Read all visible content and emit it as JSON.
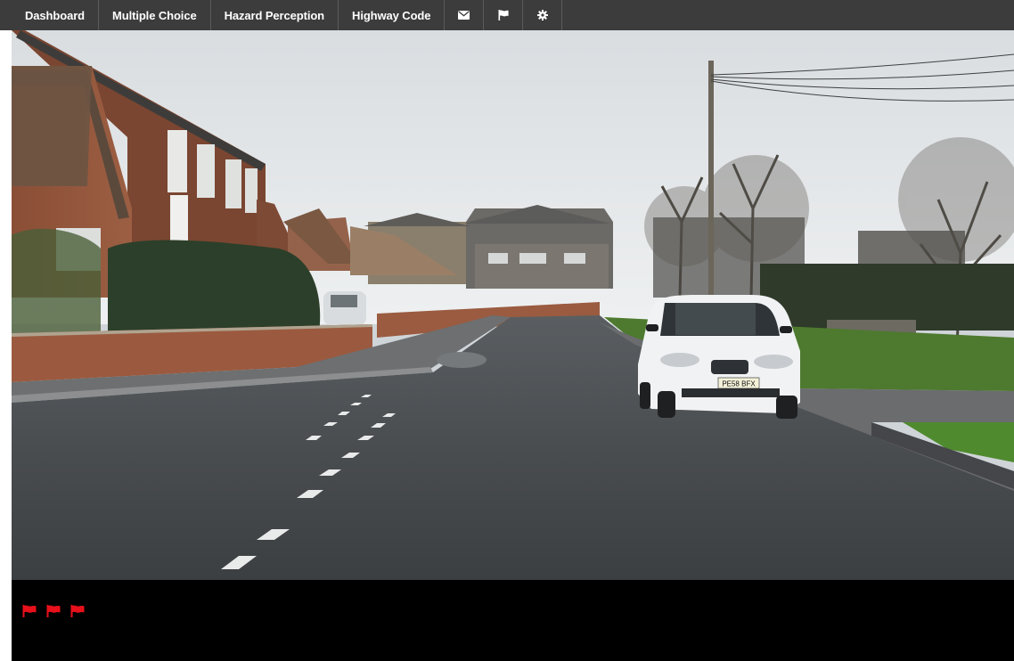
{
  "nav": {
    "items": [
      {
        "label": "Dashboard"
      },
      {
        "label": "Multiple Choice"
      },
      {
        "label": "Hazard Perception"
      },
      {
        "label": "Highway Code"
      }
    ],
    "icons": [
      "envelope-icon",
      "flag-icon",
      "gear-icon"
    ]
  },
  "video": {
    "number_plate": "PE58 BFX"
  },
  "flags": {
    "count": 3,
    "color": "#e8101a"
  },
  "colors": {
    "navbar": "#3c3c3c",
    "flag_bar": "#000000"
  }
}
